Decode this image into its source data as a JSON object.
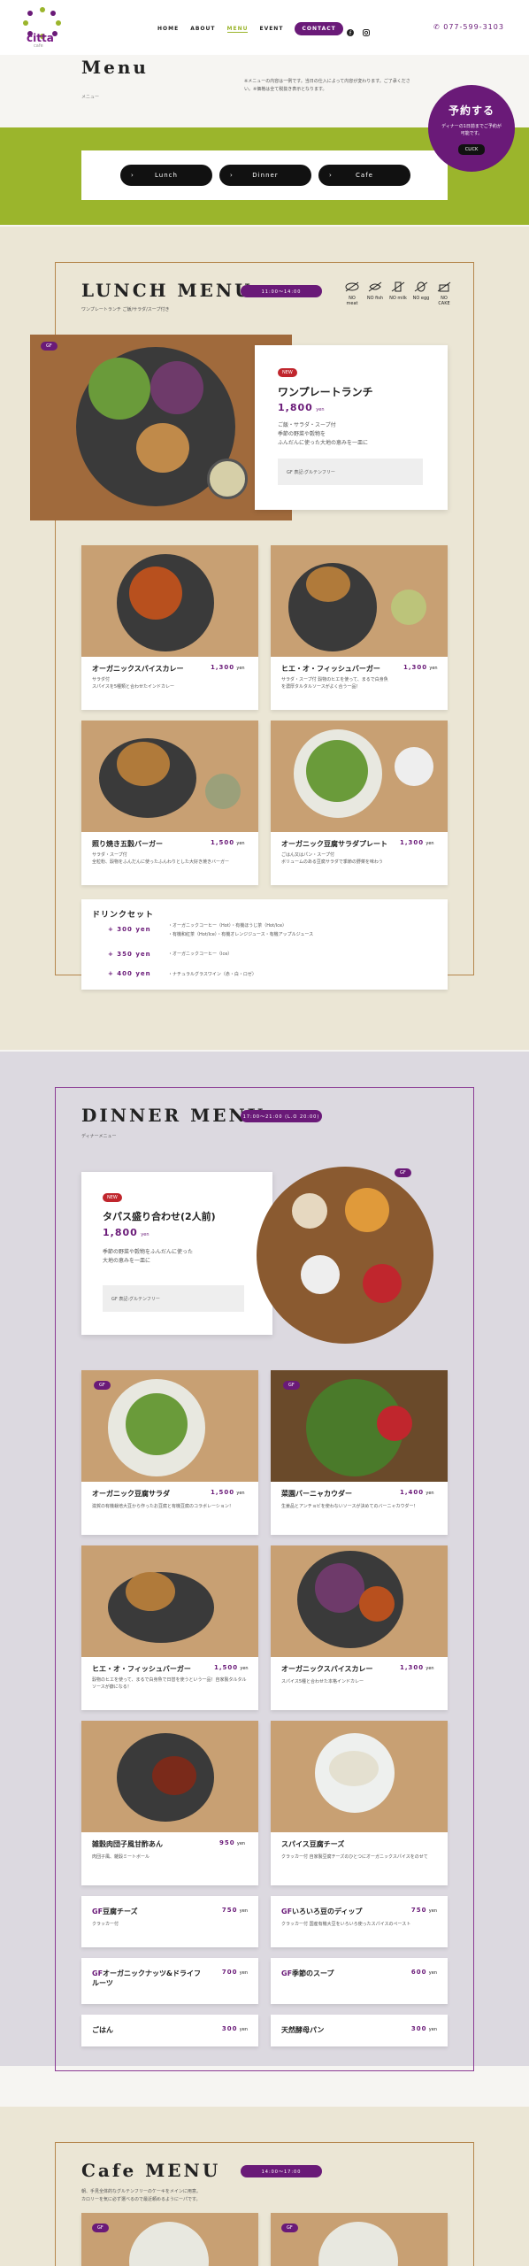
{
  "header": {
    "logo_text": "citta",
    "logo_sub": "cafe",
    "nav": [
      "HOME",
      "ABOUT",
      "MENU",
      "EVENT",
      "CONTACT"
    ],
    "phone": "077-599-3103"
  },
  "page": {
    "title": "Menu",
    "subtitle": "メニュー",
    "description": "※メニューの内容は一例です。当日の仕入によって内容が変わります。ご了承ください。※価格は全て税抜き表示となります。"
  },
  "reserve": {
    "title": "予約する",
    "text": "ディナーの1日前までご予約が可能です。",
    "button": "CLICK"
  },
  "tabs": [
    "Lunch",
    "Dinner",
    "Cafe"
  ],
  "lunch": {
    "title": "LUNCH MENU",
    "time": "11:00〜14:00",
    "subtitle": "ワンプレートランチ ご飯/サラダ/スープ付き",
    "allergens": [
      "NO meat",
      "NO fish",
      "NO milk",
      "NO egg",
      "NO CAKE"
    ],
    "featured": {
      "badge_gf": "GF",
      "badge_new": "NEW",
      "name": "ワンプレートランチ",
      "price": "1,800",
      "unit": "yen",
      "desc1": "ご飯・サラダ・スープ付",
      "desc2": "季節の野菜や穀物を",
      "desc3": "ふんだんに使った大地の恵みを一皿に",
      "gf_note": "GF 表記:グルテンフリー"
    },
    "items": [
      {
        "name": "オーガニックスパイスカレー",
        "price": "1,300",
        "unit": "yen",
        "desc1": "サラダ付",
        "desc2": "スパイスを5種類と合わせたインドカレー"
      },
      {
        "name": "ヒエ・オ・フィッシュバーガー",
        "price": "1,300",
        "unit": "yen",
        "desc1": "サラダ・スープ付 穀物のヒエを使って、まるで白身魚",
        "desc2": "を濃厚タルタルソースがよく合う一品！"
      },
      {
        "name": "照り焼き五穀バーガー",
        "price": "1,500",
        "unit": "yen",
        "desc1": "サラダ・スープ付",
        "desc2": "全粒粉、穀物をふんだんに使ったふんわりとした大好き焼きバーガー"
      },
      {
        "name": "オーガニック豆腐サラダプレート",
        "price": "1,300",
        "unit": "yen",
        "desc1": "ごはん又はパン・スープ付",
        "desc2": "ボリュームのある豆腐サラダで季節の野菜を味わう"
      }
    ],
    "drink": {
      "title": "ドリンクセット",
      "rows": [
        {
          "price": "+ 300 yen",
          "item1": "・オーガニックコーヒー（Hot）・有機ほうじ茶（Hot/Ice）",
          "item2": "・有機和紅茶（Hot/Ice）・有機オレンジジュース・有機アップルジュース"
        },
        {
          "price": "+ 350 yen",
          "item1": "・オーガニックコーヒー（Ice）",
          "item2": ""
        },
        {
          "price": "+ 400 yen",
          "item1": "・ナチュラルグラスワイン（赤・白・ロゼ）",
          "item2": ""
        }
      ]
    }
  },
  "dinner": {
    "title": "DINNER MENU",
    "time": "17:00〜21:00 (L.O 20:00)",
    "subtitle": "ディナーメニュー",
    "featured": {
      "badge_new": "NEW",
      "badge_gf": "GF",
      "name": "タパス盛り合わせ(2人前)",
      "price": "1,800",
      "unit": "yen",
      "desc1": "季節の野菜や穀物をふんだんに使った",
      "desc2": "大地の恵みを一皿に",
      "gf_note": "GF 表記:グルテンフリー"
    },
    "items": [
      {
        "badge": "GF",
        "name": "オーガニック豆腐サラダ",
        "price": "1,500",
        "unit": "yen",
        "desc": "滋賀の有機栽培大豆から作ったお豆腐と有機豆腐のコラボレーション！"
      },
      {
        "badge": "GF",
        "name": "菜園バーニャカウダー",
        "price": "1,400",
        "unit": "yen",
        "desc": "生姜品とアンチョビを使わないソースが決めてのバーニャカウダー！"
      },
      {
        "badge": "",
        "name": "ヒエ・オ・フィッシュバーガー",
        "price": "1,500",
        "unit": "yen",
        "desc": "穀物のヒエを使って、まるで白身魚で日替を使うという一品！自家製タルタルソースが癖になる！"
      },
      {
        "badge": "",
        "name": "オーガニックスパイスカレー",
        "price": "1,300",
        "unit": "yen",
        "desc": "スパイス5種と合わせた本格インドカレー"
      },
      {
        "badge": "",
        "name": "雑穀肉団子風甘酢あん",
        "price": "950",
        "unit": "yen",
        "desc": "肉団子風、雑穀ミートボール"
      },
      {
        "badge": "",
        "name": "スパイス豆腐チーズ",
        "price": "",
        "unit": "",
        "desc": "クラッカー付 自家製豆腐チーズのひとつにオーガニックスパイスをのせて"
      }
    ],
    "minis": [
      {
        "gf": "GF",
        "name": "豆腐チーズ",
        "price": "750",
        "unit": "yen",
        "desc": "クラッカー付"
      },
      {
        "gf": "GF",
        "name": "いろいろ豆のディップ",
        "price": "750",
        "unit": "yen",
        "desc": "クラッカー付 国産有機大豆をいろいろ使ったスパイスのペースト"
      },
      {
        "gf": "GF",
        "name": "オーガニックナッツ&ドライフルーツ",
        "price": "700",
        "unit": "yen",
        "desc": ""
      },
      {
        "gf": "GF",
        "name": "季節のスープ",
        "price": "600",
        "unit": "yen",
        "desc": ""
      },
      {
        "gf": "",
        "name": "ごはん",
        "price": "300",
        "unit": "yen",
        "desc": ""
      },
      {
        "gf": "",
        "name": "天然酵母パン",
        "price": "300",
        "unit": "yen",
        "desc": ""
      }
    ]
  },
  "cafe": {
    "title": "Cafe MENU",
    "time": "14:00〜17:00",
    "desc1": "朝、手見全体的なグルテンフリーのケーキをメインに用意。",
    "desc2": "カロリーを気に必ず選べるので最近頼めるようにーパです。",
    "badge_gf": "GF"
  }
}
